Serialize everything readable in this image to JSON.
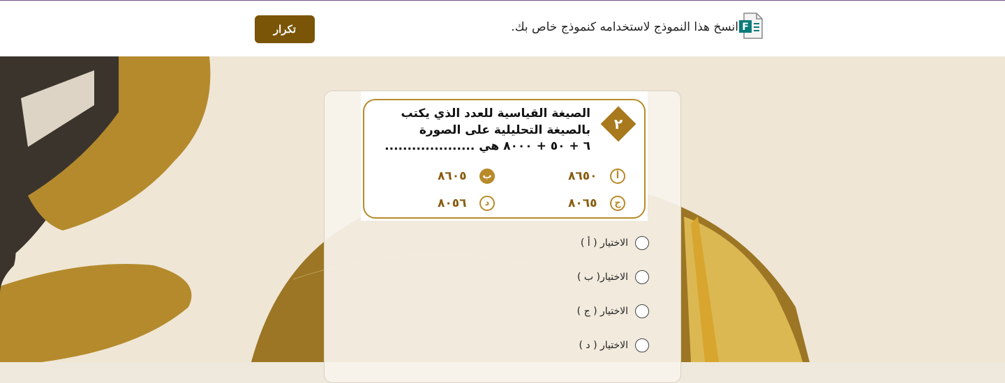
{
  "header": {
    "banner_text": "انسخ هذا النموذج لاستخدامه كنموذج خاص بك.",
    "repeat_label": "تكرار",
    "file_icon": "forms-file-icon"
  },
  "question_image": {
    "number": "٢",
    "line1": "الصيغة القياسية للعدد الذي يكتب",
    "line2": "بالصيغة التحليلية على الصورة",
    "line3": "٦ + ٥٠ + ٨٠٠٠ هي ....................",
    "options": [
      {
        "letter": "أ",
        "value": "٨٦٥٠"
      },
      {
        "letter": "ب",
        "value": "٨٦٠٥"
      },
      {
        "letter": "ج",
        "value": "٨٠٦٥"
      },
      {
        "letter": "د",
        "value": "٨٠٥٦"
      }
    ]
  },
  "choices": [
    {
      "label": "الاختيار ( أ )"
    },
    {
      "label": "الاختيار( ب )"
    },
    {
      "label": "الاختيار ( ج )"
    },
    {
      "label": "الاختيار ( د )"
    }
  ],
  "colors": {
    "accent": "#7a5407",
    "gold": "#b88a2a",
    "top_line": "#7a4f8c"
  }
}
